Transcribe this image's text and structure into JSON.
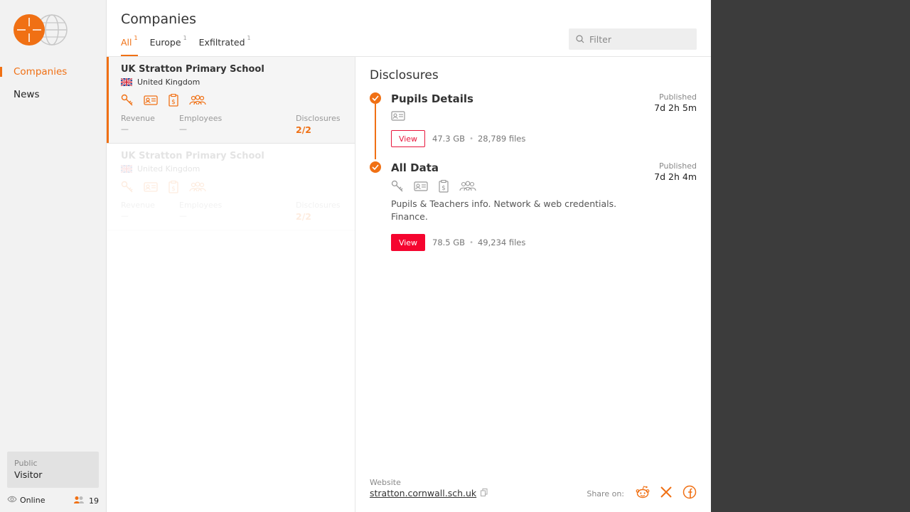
{
  "sidebar": {
    "nav": [
      {
        "label": "Companies",
        "active": true
      },
      {
        "label": "News",
        "active": false
      }
    ],
    "user": {
      "role": "Public",
      "name": "Visitor"
    },
    "status": {
      "label": "Online",
      "count": "19"
    }
  },
  "header": {
    "title": "Companies",
    "tabs": [
      {
        "label": "All",
        "count": "1",
        "active": true
      },
      {
        "label": "Europe",
        "count": "1",
        "active": false
      },
      {
        "label": "Exfiltrated",
        "count": "1",
        "active": false
      }
    ],
    "search": {
      "placeholder": "Filter"
    }
  },
  "companies": [
    {
      "name": "UK Stratton Primary School",
      "country": "United Kingdom",
      "revenue_label": "Revenue",
      "revenue": "—",
      "employees_label": "Employees",
      "employees": "—",
      "disclosures_label": "Disclosures",
      "disclosures": "2/2",
      "icons": [
        "key-icon",
        "id-card-icon",
        "finance-icon",
        "people-icon"
      ]
    },
    {
      "name": "UK Stratton Primary School",
      "country": "United Kingdom",
      "revenue_label": "Revenue",
      "revenue": "—",
      "employees_label": "Employees",
      "employees": "—",
      "disclosures_label": "Disclosures",
      "disclosures": "2/2",
      "icons": [
        "key-icon",
        "id-card-icon",
        "finance-icon",
        "people-icon"
      ]
    }
  ],
  "detail": {
    "title": "Disclosures",
    "items": [
      {
        "name": "Pupils Details",
        "published_label": "Published",
        "published_ago": "7d 2h 5m",
        "icons": [
          "id-card-icon"
        ],
        "description": "",
        "view_label": "View",
        "size": "47.3 GB",
        "files": "28,789 files"
      },
      {
        "name": "All Data",
        "published_label": "Published",
        "published_ago": "7d 2h 4m",
        "icons": [
          "key-icon",
          "id-card-icon",
          "finance-icon",
          "people-icon"
        ],
        "description": "Pupils & Teachers info. Network & web credentials. Finance.",
        "view_label": "View",
        "size": "78.5 GB",
        "files": "49,234 files"
      }
    ],
    "website_label": "Website",
    "website": "stratton.cornwall.sch.uk",
    "share_label": "Share on:",
    "share_icons": [
      "reddit-icon",
      "x-icon",
      "facebook-icon"
    ]
  },
  "colors": {
    "accent": "#f07014",
    "view_button": "#f5052f",
    "dark_area": "#3c3c3c"
  }
}
